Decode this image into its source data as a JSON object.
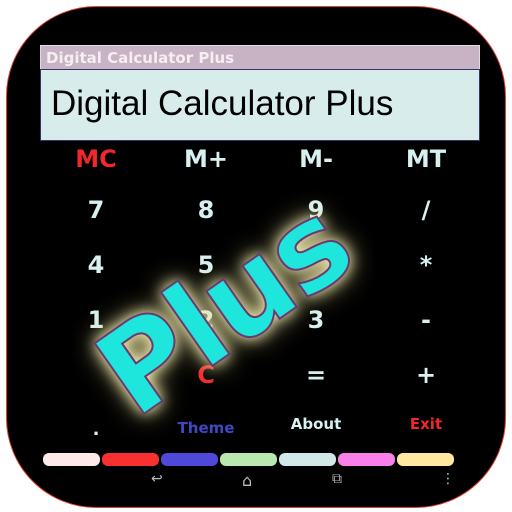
{
  "app": {
    "title": "Digital Calculator Plus"
  },
  "display": {
    "value": "Digital Calculator Plus"
  },
  "overlay": {
    "text": "Plus",
    "color": "#1ee6dc"
  },
  "keys": [
    [
      "MC",
      "M+",
      "M-",
      "MT"
    ],
    [
      "7",
      "8",
      "9",
      "/"
    ],
    [
      "4",
      "5",
      "",
      "*"
    ],
    [
      "1",
      "2",
      "3",
      "-"
    ],
    [
      "",
      "C",
      "=",
      "+"
    ],
    [
      ".",
      "Theme",
      "About",
      "Exit"
    ]
  ],
  "theme_colors": [
    "#ffe8e8",
    "#f83030",
    "#5048d8",
    "#b8e8b0",
    "#d0e8e8",
    "#f880e8",
    "#ffe8a0"
  ],
  "nav": {
    "back": "back-icon",
    "home": "home-icon",
    "recents": "recents-icon",
    "menu": "menu-icon"
  }
}
